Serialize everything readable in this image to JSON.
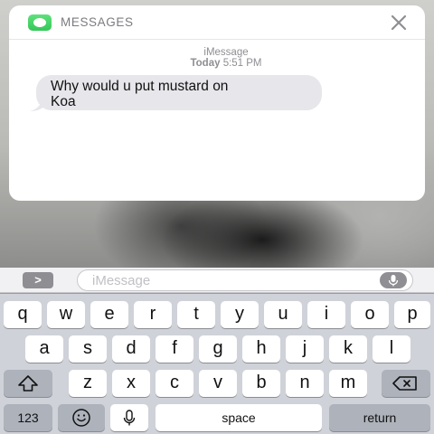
{
  "notification": {
    "app_name": "MESSAGES",
    "close_glyph": "✕",
    "service": "iMessage",
    "day": "Today",
    "time": "5:51 PM",
    "message_line1": "Why would u put mustard on",
    "message_line2": "Koa",
    "app_icon": "messages-app-icon"
  },
  "input_bar": {
    "apps_glyph": ">",
    "placeholder": "iMessage",
    "mic_icon": "microphone-icon"
  },
  "keyboard": {
    "row1": [
      "q",
      "w",
      "e",
      "r",
      "t",
      "y",
      "u",
      "i",
      "o",
      "p"
    ],
    "row2": [
      "a",
      "s",
      "d",
      "f",
      "g",
      "h",
      "j",
      "k",
      "l"
    ],
    "row3": [
      "z",
      "x",
      "c",
      "v",
      "b",
      "n",
      "m"
    ],
    "shift_icon": "shift-icon",
    "delete_icon": "delete-icon",
    "numbers_label": "123",
    "emoji_icon": "emoji-icon",
    "dictation_icon": "microphone-icon",
    "space_label": "space",
    "return_label": "return"
  },
  "colors": {
    "bubble": "#e6e6eb",
    "messages_green": "#34c759",
    "keyboard_bg": "#cfd2d8",
    "key_dark": "#adb2bb"
  }
}
